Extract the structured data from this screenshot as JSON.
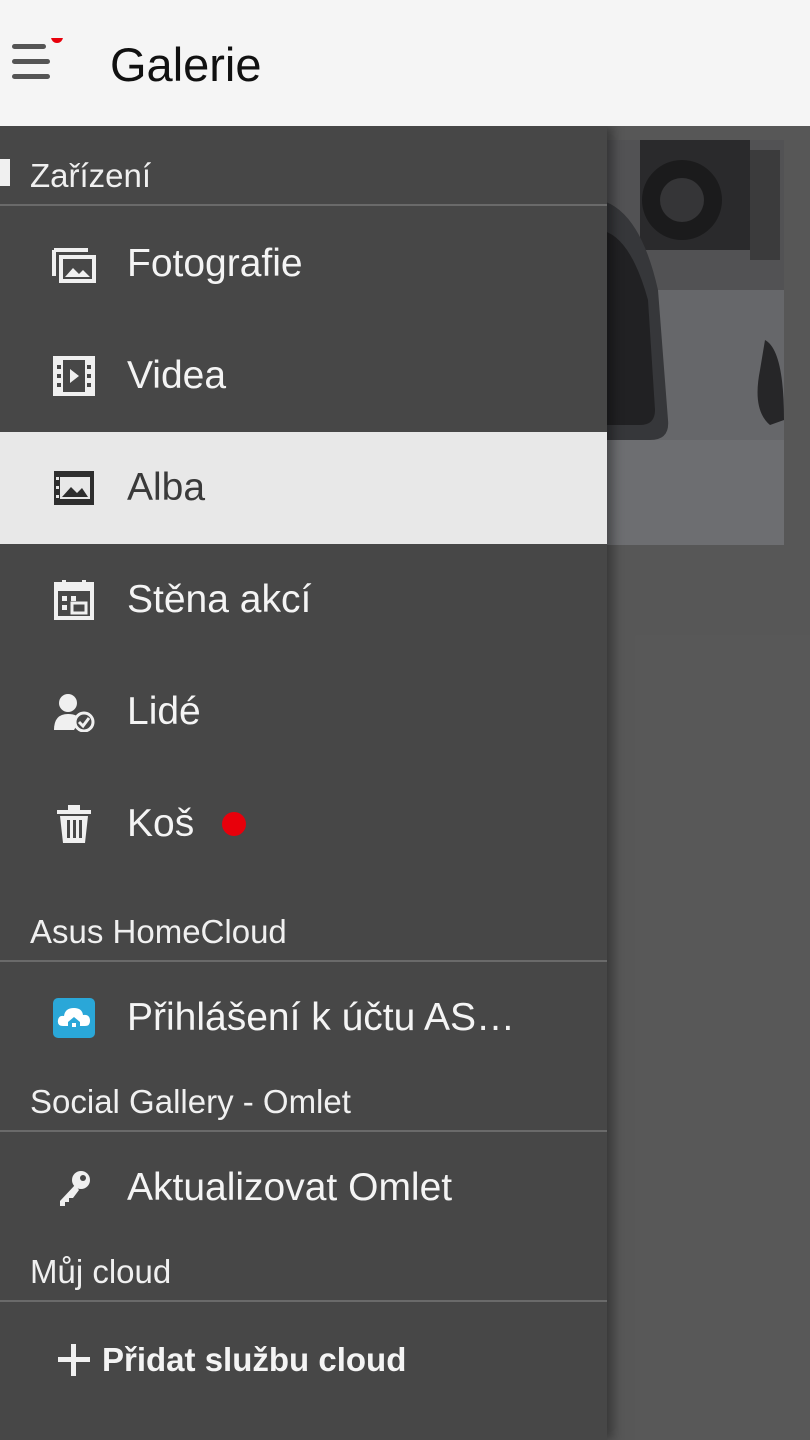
{
  "app": {
    "title": "Galerie",
    "menu_has_notification": true
  },
  "drawer": {
    "sections": {
      "device": "Zařízení",
      "homecloud": "Asus HomeCloud",
      "social": "Social Gallery - Omlet",
      "mycloud": "Můj cloud"
    },
    "items": {
      "photos": "Fotografie",
      "videos": "Videa",
      "albums": "Alba",
      "event_wall": "Stěna akcí",
      "people": "Lidé",
      "trash": "Koš",
      "asus_login": "Přihlášení k účtu AS…",
      "update_omlet": "Aktualizovat Omlet"
    },
    "selected_item": "albums",
    "add_cloud": "Přidat službu cloud"
  },
  "colors": {
    "drawer_bg": "#474747",
    "selected_bg": "#e8e8e8",
    "notification_dot": "#e8000b",
    "cloud_icon": "#2aa7d8"
  },
  "icons": {
    "menu": "hamburger-icon",
    "photos": "photos-icon",
    "videos": "film-icon",
    "albums": "album-icon",
    "event_wall": "calendar-icon",
    "people": "person-check-icon",
    "trash": "trash-icon",
    "asus_login": "cloud-home-icon",
    "update_omlet": "key-icon",
    "add_cloud": "plus-icon"
  }
}
